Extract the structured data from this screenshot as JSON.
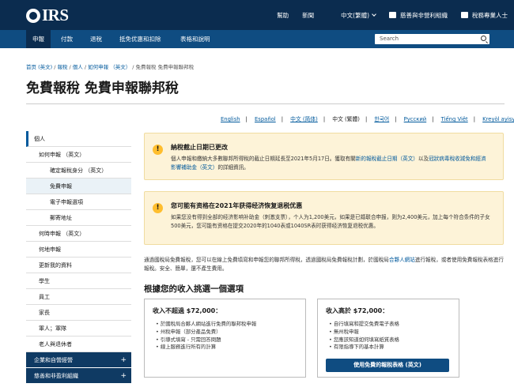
{
  "header": {
    "logo_text": "IRS",
    "utility_links": [
      "幫助",
      "新聞",
      "中文(繁體)",
      "慈善與非營利組織",
      "稅務專業人士"
    ]
  },
  "nav": {
    "items": [
      "申報",
      "付款",
      "退稅",
      "抵免优惠和扣除",
      "表格和說明"
    ],
    "active": "申報"
  },
  "search": {
    "placeholder": "Search"
  },
  "breadcrumb": {
    "items": [
      "首页 (英文)",
      "報稅",
      "個人",
      "如何申報 （英文）"
    ],
    "current": "免費報稅 免費申報聯邦稅"
  },
  "page_title": "免費報稅 免費申報聯邦稅",
  "languages": [
    "English",
    "Español",
    "中文 (简体)",
    "中文 (繁體)",
    "한국어",
    "Русский",
    "Tiếng Việt",
    "Kreyòl ayisyen"
  ],
  "current_language": "中文 (繁體)",
  "sidebar": {
    "items": [
      {
        "label": "個人",
        "level": 0
      },
      {
        "label": "如何申報 （英文）",
        "level": 1
      },
      {
        "label": "確定報稅身分 （英文）",
        "level": 2
      },
      {
        "label": "免費申報",
        "level": 2
      },
      {
        "label": "電子申報選項",
        "level": 2
      },
      {
        "label": "郵寄地址",
        "level": 2
      },
      {
        "label": "何時申報 （英文）",
        "level": 1
      },
      {
        "label": "何地申報",
        "level": 1
      },
      {
        "label": "更新我的資料",
        "level": 1
      },
      {
        "label": "學生",
        "level": 1
      },
      {
        "label": "員工",
        "level": 1
      },
      {
        "label": "家長",
        "level": 1
      },
      {
        "label": "軍人；軍隊",
        "level": 1
      },
      {
        "label": "老人與退休者",
        "level": 1
      },
      {
        "label": "企業和自營經營",
        "level": 0
      },
      {
        "label": "慈善和非盈利組織",
        "level": 0
      }
    ]
  },
  "alerts": [
    {
      "title": "納稅截止日期已更改",
      "body_prefix": "個人申報和繳納大多數聯邦所得稅的截止日期延長至2021年5月17日。獲取有關",
      "link1": "新的報稅截止日期（英文）",
      "body_mid": "以及",
      "link2": "冠狀病毒稅收減免和經濟影響補助金（英文）",
      "body_suffix": "的詳細資訊。"
    },
    {
      "title": "您可能有资格在2021年获得经济恢复退税优惠",
      "body": "如果您没有得到全部的经济影响补助金（刺激支票），个人为1,200美元，如果是已婚联合申报，则为2,400美元，加上每个符合条件的子女500美元，您可能有资格在提交2020年的1040表或1040SR表时获得经济恢复退税优惠。"
    }
  ],
  "intro": {
    "text_prefix": "通過國稅局免費報稅，您可以在線上免費填寫和申報您的聯邦所得稅，透過國稅局免費報稅計劃，於國稅局",
    "link": "合夥人網站",
    "text_suffix": "進行報稅，或者使用免費報稅表格進行報稅。安全、簡單，還不產生費用。"
  },
  "choose_heading": "根據您的收入挑選一個選項",
  "cards": [
    {
      "title": "收入不超過 $72,000：",
      "items": [
        "於國稅局合夥人網站進行免費的聯邦稅申報",
        "州稅申報（部分產品免費）",
        "引導式填寫 - 只需回答問題",
        "線上服務進行所有的計算"
      ]
    },
    {
      "title": "收入高於 $72,000：",
      "items": [
        "自行填寫和提交免費電子表格",
        "無州稅申報",
        "您應該知道如何填寫紙質表格",
        "有限指導下的基本計算"
      ],
      "button": "使用免費的報稅表格 (英文)"
    }
  ],
  "colors": {
    "navy": "#0b2c4f",
    "nav_blue": "#0f4c81",
    "alert_bg": "#fdf3d8",
    "alert_icon": "#ffbe2e",
    "link": "#00599c"
  }
}
